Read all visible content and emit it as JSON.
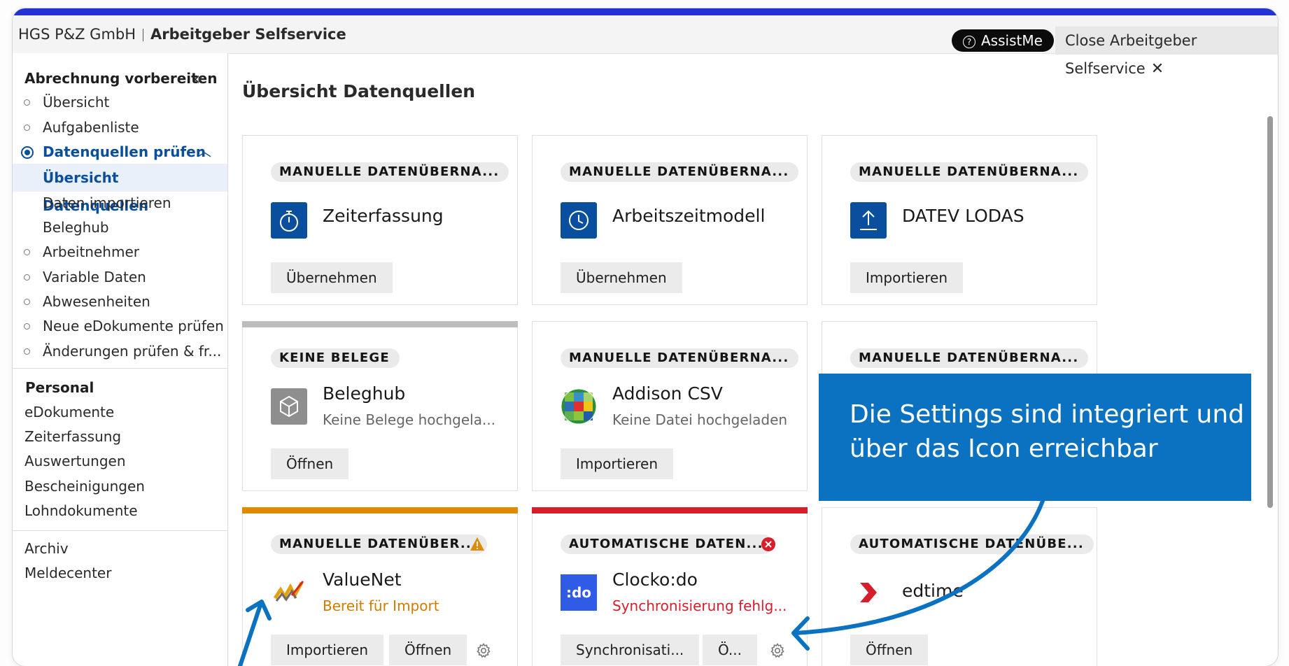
{
  "header": {
    "company": "HGS P&Z GmbH",
    "app": "Arbeitgeber Selfservice",
    "assist_label": "AssistMe",
    "close_label": "Close Arbeitgeber Selfservice"
  },
  "sidebar": {
    "title": "Abrechnung vorbereiten",
    "nav": [
      {
        "label": "Übersicht"
      },
      {
        "label": "Aufgabenliste"
      },
      {
        "label": "Datenquellen prüfen"
      },
      {
        "label": "Übersicht Datenquellen"
      },
      {
        "label": "Daten importieren"
      },
      {
        "label": "Beleghub"
      },
      {
        "label": "Arbeitnehmer"
      },
      {
        "label": "Variable Daten"
      },
      {
        "label": "Abwesenheiten"
      },
      {
        "label": "Neue eDokumente prüfen"
      },
      {
        "label": "Änderungen prüfen & fr..."
      }
    ],
    "section_personal": "Personal",
    "personal_links": [
      "eDokumente",
      "Zeiterfassung",
      "Auswertungen",
      "Bescheinigungen",
      "Lohndokumente"
    ],
    "archive": "Archiv",
    "cut_link": "Meldecenter"
  },
  "main": {
    "title": "Übersicht Datenquellen",
    "cards": [
      {
        "badge": "MANUELLE DATENÜBERNA...",
        "name": "Zeiterfassung",
        "sub": "",
        "buttons": [
          "Übernehmen"
        ]
      },
      {
        "badge": "MANUELLE DATENÜBERNA...",
        "name": "Arbeitszeitmodell",
        "sub": "",
        "buttons": [
          "Übernehmen"
        ]
      },
      {
        "badge": "MANUELLE DATENÜBERNA...",
        "name": "DATEV LODAS",
        "sub": "",
        "buttons": [
          "Importieren"
        ]
      },
      {
        "badge": "KEINE BELEGE",
        "name": "Beleghub",
        "sub": "Keine Belege hochgela...",
        "buttons": [
          "Öffnen"
        ]
      },
      {
        "badge": "MANUELLE DATENÜBERNA...",
        "name": "Addison CSV",
        "sub": "Keine Datei hochgeladen",
        "buttons": [
          "Importieren"
        ]
      },
      {
        "badge": "MANUELLE DATENÜBERNA...",
        "name": "",
        "sub": "",
        "buttons": []
      },
      {
        "badge": "MANUELLE DATENÜBER...",
        "name": "ValueNet",
        "sub": "Bereit für Import",
        "buttons": [
          "Importieren",
          "Öffnen"
        ]
      },
      {
        "badge": "AUTOMATISCHE DATEN...",
        "name": "Clocko:do",
        "sub": "Synchronisierung fehlg...",
        "buttons": [
          "Synchronisati...",
          "Ö..."
        ]
      },
      {
        "badge": "AUTOMATISCHE DATENÜBE...",
        "name": "edtime",
        "sub": "",
        "buttons": [
          "Öffnen"
        ]
      }
    ],
    "clockodo_logo_text": ":do"
  },
  "callout": {
    "line1": "Die Settings sind integriert und",
    "line2": "über das Icon erreichbar"
  },
  "colors": {
    "accent": "#2133d4",
    "primary_blue": "#0a4f9e",
    "callout_blue": "#0a72c0",
    "warning_orange": "#e08a00",
    "error_red": "#d71e2b",
    "neutral_gray": "#bdbdbd"
  }
}
